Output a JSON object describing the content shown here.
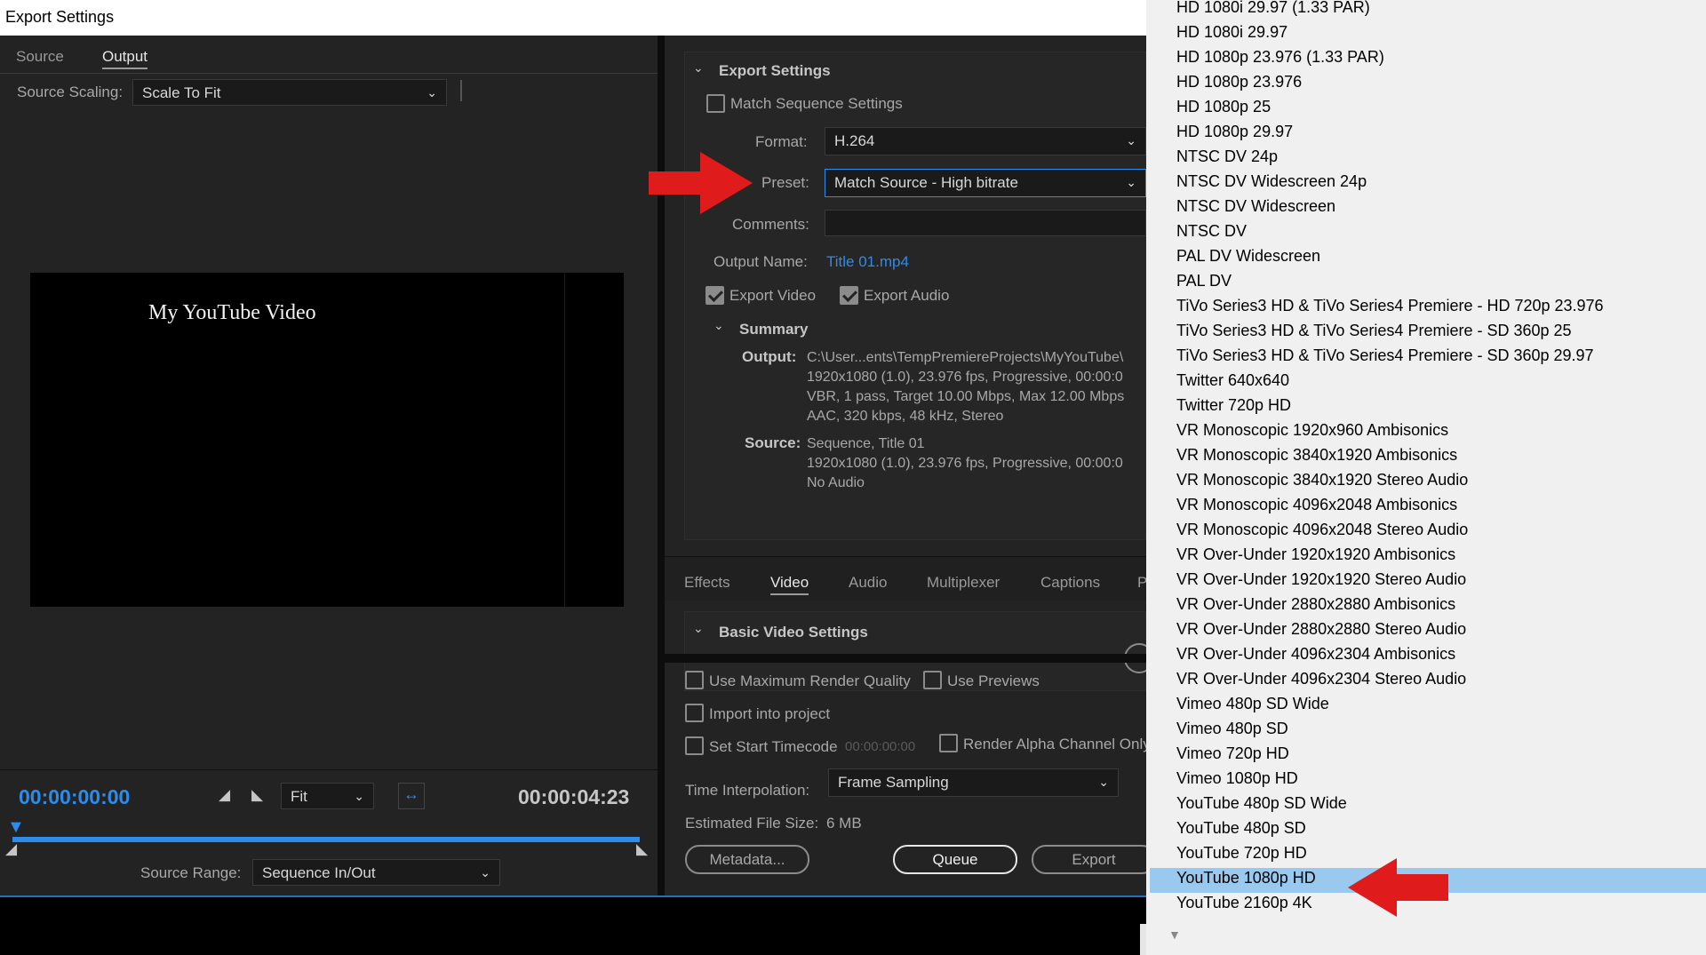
{
  "window": {
    "title": "Export Settings"
  },
  "left": {
    "tabs": [
      "Source",
      "Output"
    ],
    "source_scaling_label": "Source Scaling:",
    "source_scaling_value": "Scale To Fit",
    "preview_text": "My YouTube Video",
    "timecode_start": "00:00:00:00",
    "timecode_end": "00:00:04:23",
    "zoom_value": "Fit",
    "source_range_label": "Source Range:",
    "source_range_value": "Sequence In/Out"
  },
  "export_settings": {
    "heading": "Export Settings",
    "match_sequence": "Match Sequence Settings",
    "format_label": "Format:",
    "format_value": "H.264",
    "preset_label": "Preset:",
    "preset_value": "Match Source - High bitrate",
    "comments_label": "Comments:",
    "output_name_label": "Output Name:",
    "output_name_value": "Title 01.mp4",
    "export_video": "Export Video",
    "export_audio": "Export Audio",
    "summary_heading": "Summary",
    "output_label": "Output:",
    "output_lines": [
      "C:\\User...ents\\TempPremiereProjects\\MyYouTube\\",
      "1920x1080 (1.0), 23.976 fps, Progressive, 00:00:0",
      "VBR, 1 pass, Target 10.00 Mbps, Max 12.00 Mbps",
      "AAC, 320 kbps, 48 kHz, Stereo"
    ],
    "source_label": "Source:",
    "source_lines": [
      "Sequence, Title 01",
      "1920x1080 (1.0), 23.976 fps, Progressive, 00:00:0",
      "No Audio"
    ]
  },
  "bottom_tabs": [
    "Effects",
    "Video",
    "Audio",
    "Multiplexer",
    "Captions",
    "P"
  ],
  "basic_video": {
    "heading": "Basic Video Settings"
  },
  "options": {
    "use_max_quality": "Use Maximum Render Quality",
    "use_previews": "Use Previews",
    "import_into_project": "Import into project",
    "set_start_timecode": "Set Start Timecode",
    "start_timecode_value": "00:00:00:00",
    "render_alpha": "Render Alpha Channel Only",
    "time_interp_label": "Time Interpolation:",
    "time_interp_value": "Frame Sampling",
    "est_size_label": "Estimated File Size:",
    "est_size_value": "6 MB",
    "metadata_button": "Metadata...",
    "queue_button": "Queue",
    "export_button": "Export"
  },
  "preset_dropdown": {
    "items": [
      "HD 1080i 29.97 (1.33 PAR)",
      "HD 1080i 29.97",
      "HD 1080p 23.976 (1.33 PAR)",
      "HD 1080p 23.976",
      "HD 1080p 25",
      "HD 1080p 29.97",
      "NTSC DV 24p",
      "NTSC DV Widescreen 24p",
      "NTSC DV Widescreen",
      "NTSC DV",
      "PAL DV Widescreen",
      "PAL DV",
      "TiVo Series3 HD & TiVo Series4 Premiere - HD 720p 23.976",
      "TiVo Series3 HD & TiVo Series4 Premiere - SD 360p 25",
      "TiVo Series3 HD & TiVo Series4 Premiere - SD 360p 29.97",
      "Twitter 640x640",
      "Twitter 720p HD",
      "VR Monoscopic 1920x960 Ambisonics",
      "VR Monoscopic 3840x1920 Ambisonics",
      "VR Monoscopic 3840x1920 Stereo Audio",
      "VR Monoscopic 4096x2048 Ambisonics",
      "VR Monoscopic 4096x2048 Stereo Audio",
      "VR Over-Under 1920x1920 Ambisonics",
      "VR Over-Under 1920x1920 Stereo Audio",
      "VR Over-Under 2880x2880 Ambisonics",
      "VR Over-Under 2880x2880 Stereo Audio",
      "VR Over-Under 4096x2304 Ambisonics",
      "VR Over-Under 4096x2304 Stereo Audio",
      "Vimeo 480p SD Wide",
      "Vimeo 480p SD",
      "Vimeo 720p HD",
      "Vimeo 1080p HD",
      "YouTube 480p SD Wide",
      "YouTube 480p SD",
      "YouTube 720p HD",
      "YouTube 1080p HD",
      "YouTube 2160p 4K"
    ],
    "selected": "YouTube 1080p HD"
  },
  "colors": {
    "accent_blue": "#2d8ceb",
    "selection": "#99c9ef",
    "arrow_red": "#e01b1b"
  }
}
